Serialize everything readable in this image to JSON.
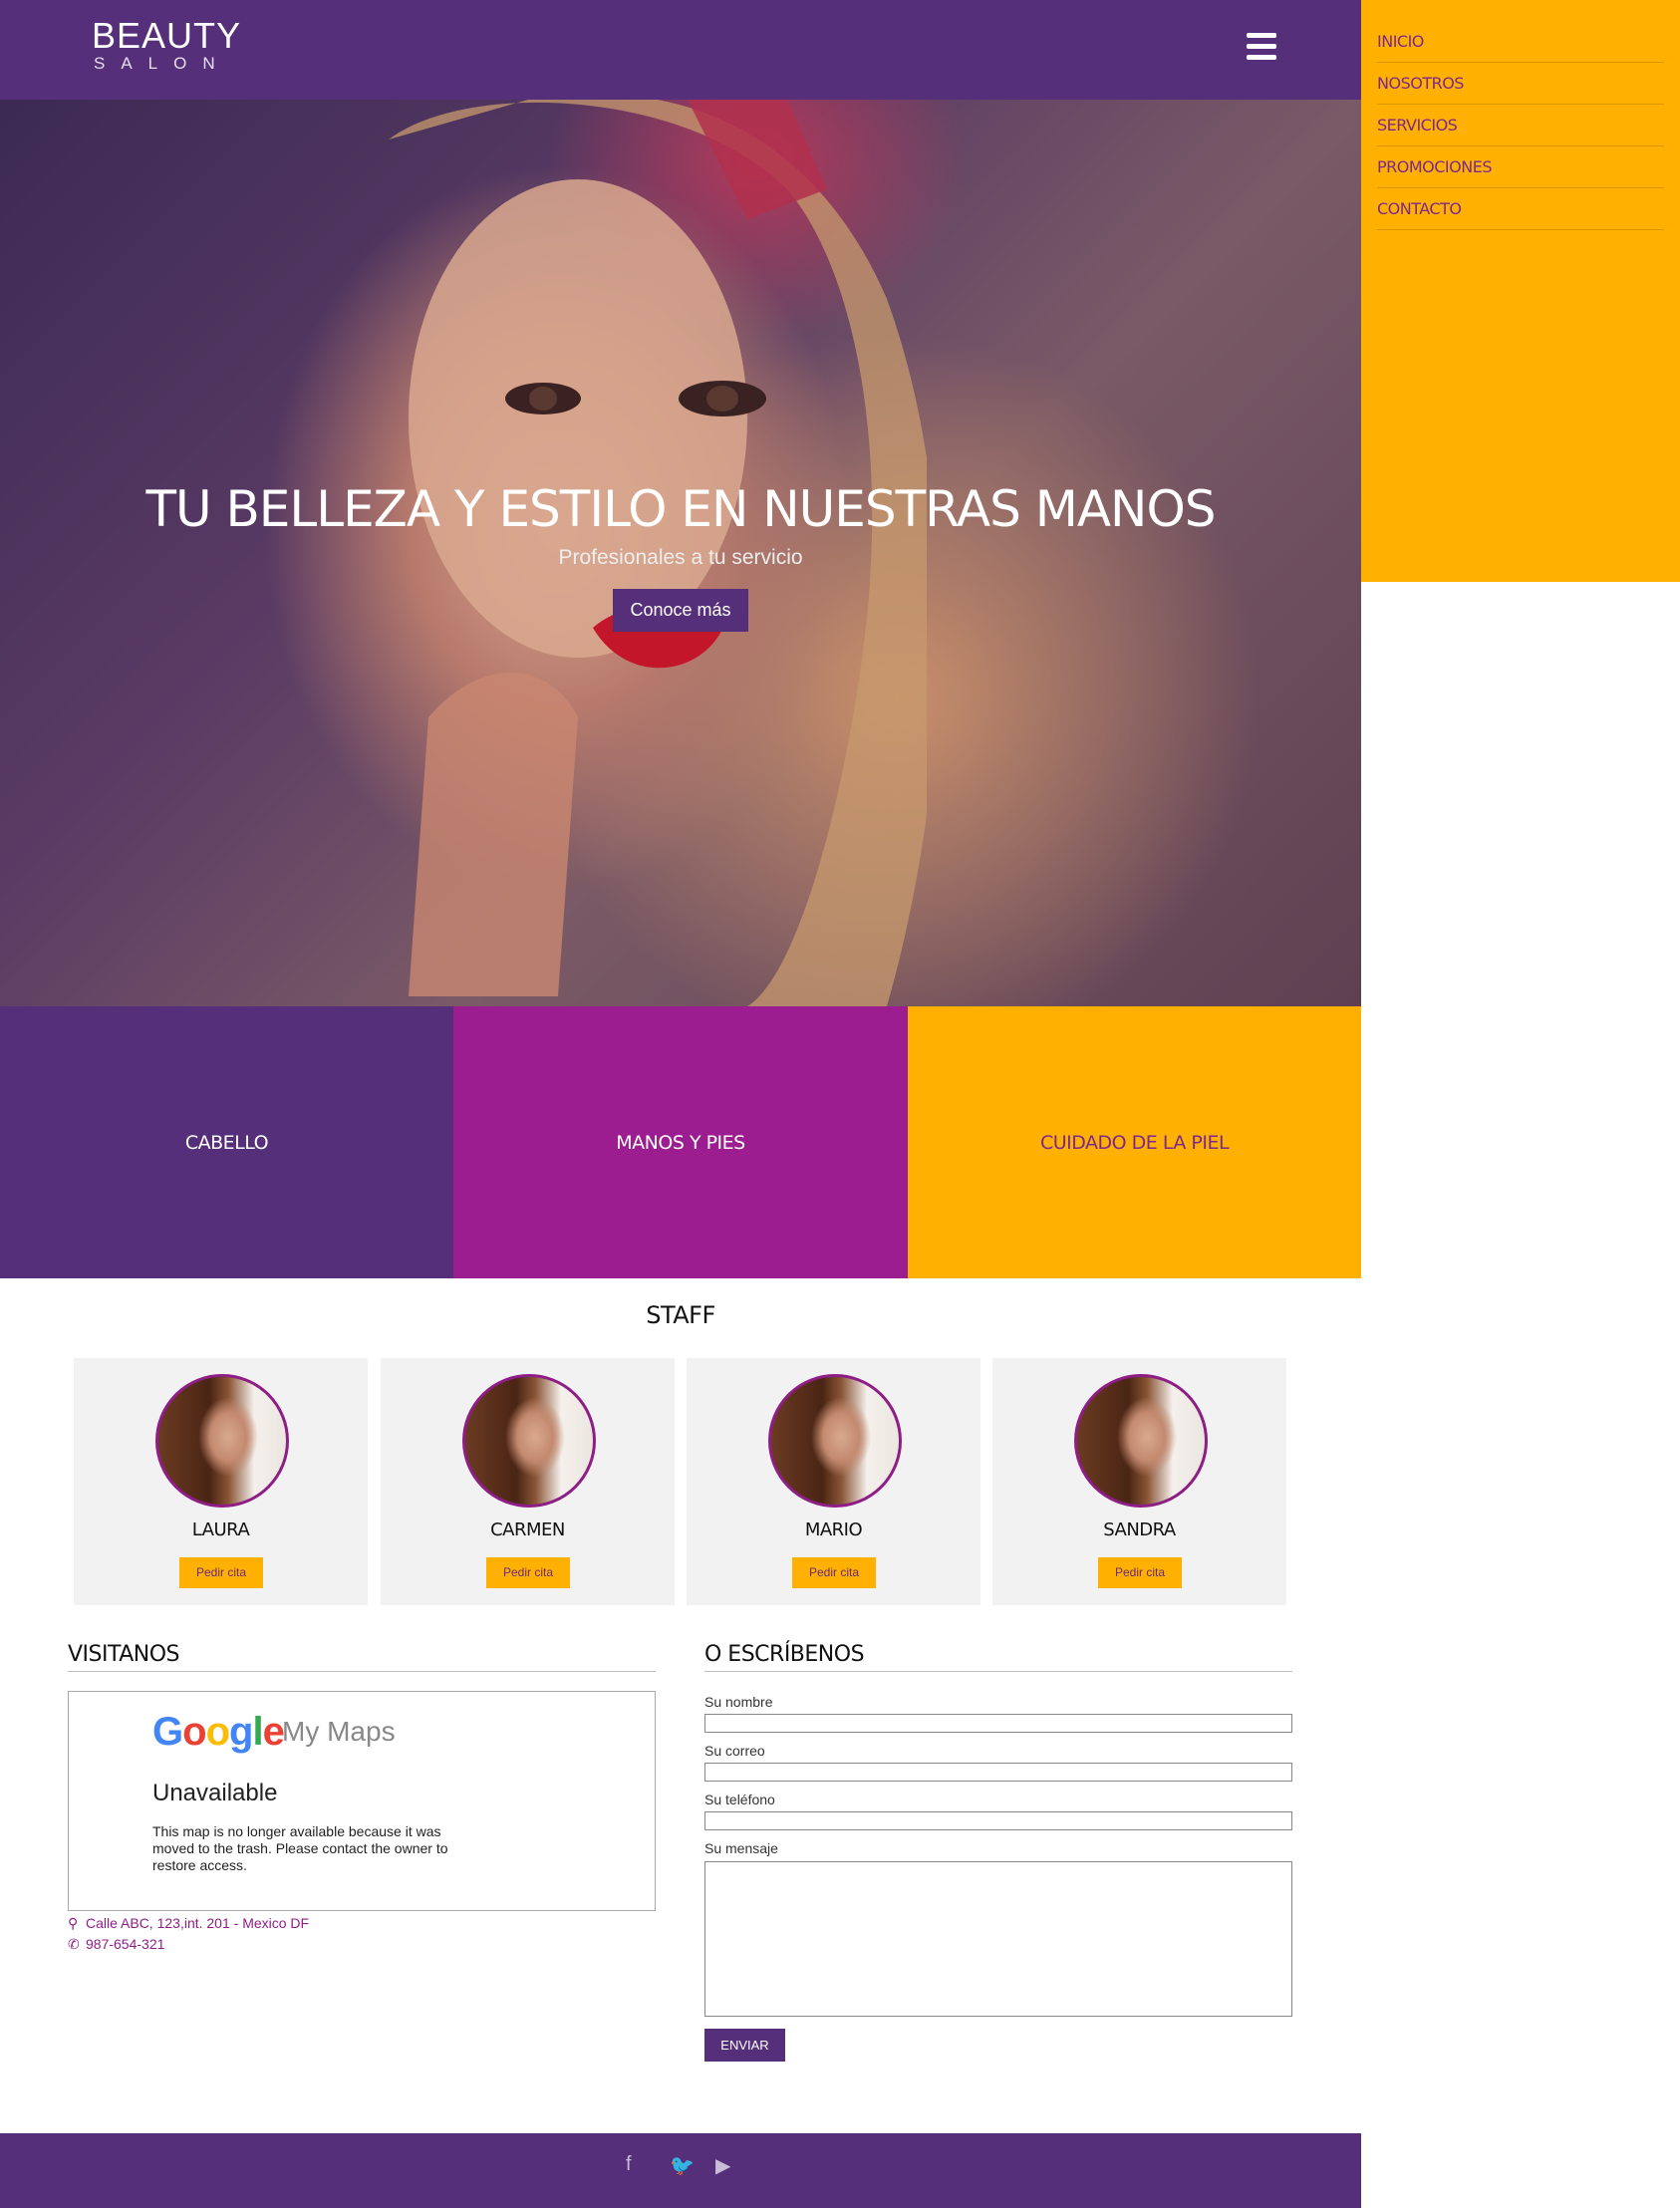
{
  "colors": {
    "primary": "#562f7a",
    "magenta": "#9b1d8f",
    "accent": "#ffb000"
  },
  "header": {
    "logo_line1": "BEAUTY",
    "logo_line2": "SALON",
    "menu_icon": "hamburger-icon"
  },
  "nav": {
    "items": [
      "INICIO",
      "NOSOTROS",
      "SERVICIOS",
      "PROMOCIONES",
      "CONTACTO"
    ]
  },
  "hero": {
    "title": "TU BELLEZA Y ESTILO EN NUESTRAS MANOS",
    "subtitle": "Profesionales a tu servicio",
    "button": "Conoce más"
  },
  "services": [
    "CABELLO",
    "MANOS Y PIES",
    "CUIDADO DE LA PIEL"
  ],
  "staff": {
    "title": "STAFF",
    "members": [
      {
        "name": "LAURA",
        "button": "Pedir cita"
      },
      {
        "name": "CARMEN",
        "button": "Pedir cita"
      },
      {
        "name": "MARIO",
        "button": "Pedir cita"
      },
      {
        "name": "SANDRA",
        "button": "Pedir cita"
      }
    ]
  },
  "visit": {
    "title": "VISITANOS",
    "map_brand": "Google",
    "map_product": "My Maps",
    "map_status": "Unavailable",
    "map_message": "This map is no longer available because it was moved to the trash. Please contact the owner to restore access.",
    "address": "Calle ABC, 123,int. 201 - Mexico DF",
    "phone": "987-654-321"
  },
  "contact": {
    "title": "O ESCRÍBENOS",
    "labels": {
      "name": "Su nombre",
      "email": "Su correo",
      "phone": "Su teléfono",
      "message": "Su mensaje"
    },
    "submit": "ENVIAR"
  },
  "footer": {
    "social_icons": [
      "facebook-icon",
      "twitter-icon",
      "youtube-icon"
    ]
  }
}
